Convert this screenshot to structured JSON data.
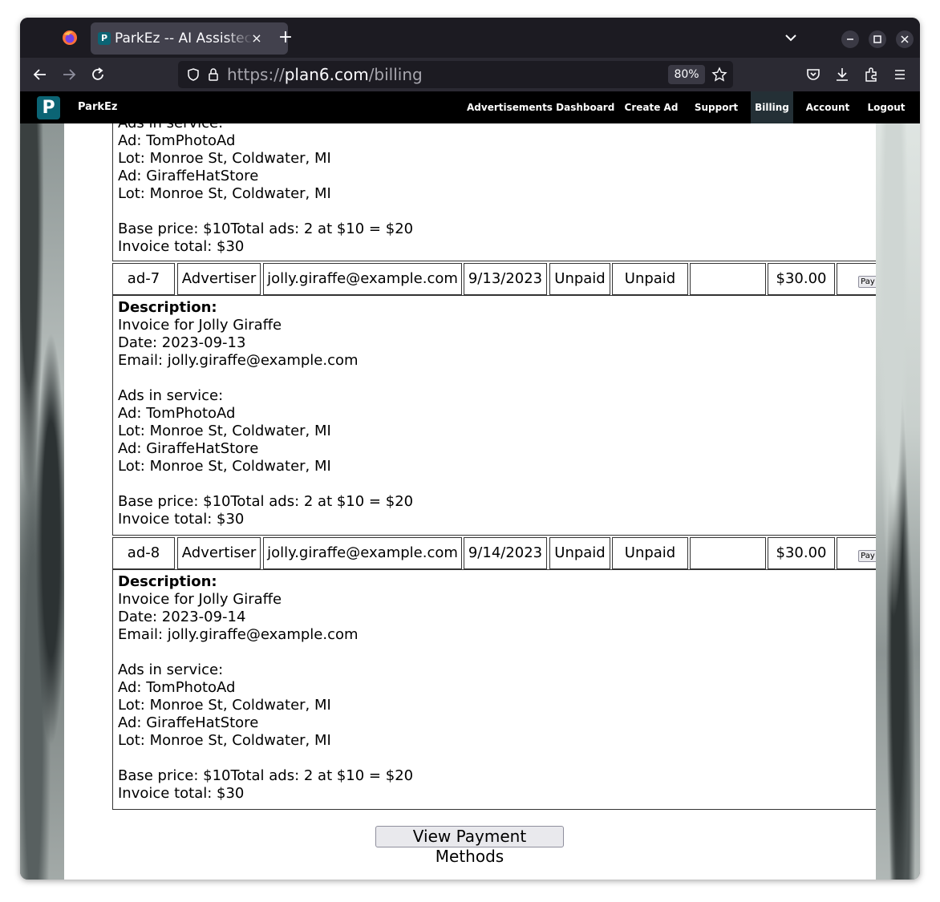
{
  "browser": {
    "tab_title": "ParkEz -- AI Assistec",
    "tab_favicon_letter": "P",
    "close_tab_glyph": "×",
    "new_tab_glyph": "+",
    "url_scheme": "https://",
    "url_host": "plan6.com",
    "url_path": "/billing",
    "zoom_level": "80%",
    "window_controls": [
      "minimize-icon",
      "maximize-icon",
      "close-icon"
    ],
    "toolbar_icons": [
      "back-icon",
      "forward-icon",
      "reload-icon",
      "shield-icon",
      "lock-icon",
      "bookmark-star-icon",
      "pocket-icon",
      "download-icon",
      "extensions-icon",
      "menu-icon"
    ]
  },
  "appnav": {
    "logo_letter": "P",
    "brand": "ParkEz",
    "links": [
      "Advertisements Dashboard",
      "Create Ad",
      "Support",
      "Billing",
      "Account",
      "Logout"
    ],
    "active": "Billing"
  },
  "billing": {
    "first_desc_partial": {
      "lines": [
        "Ads in service:",
        "Ad: TomPhotoAd",
        "Lot: Monroe St, Coldwater, MI",
        "Ad: GiraffeHatStore",
        "Lot: Monroe St, Coldwater, MI",
        "",
        "Base price: $10Total ads: 2 at $10 = $20",
        "Invoice total: $30"
      ]
    },
    "invoices": [
      {
        "row": {
          "id": "ad-7",
          "type": "Advertiser",
          "email": "jolly.giraffe@example.com",
          "date": "9/13/2023",
          "status": "Unpaid",
          "payment_status": "Unpaid",
          "blank": "",
          "amount": "$30.00",
          "pay_label": "Pay"
        },
        "desc": {
          "heading": "Description:",
          "lines": [
            "Invoice for Jolly Giraffe",
            "Date: 2023-09-13",
            "Email: jolly.giraffe@example.com",
            "",
            "Ads in service:",
            "Ad: TomPhotoAd",
            "Lot: Monroe St, Coldwater, MI",
            "Ad: GiraffeHatStore",
            "Lot: Monroe St, Coldwater, MI",
            "",
            "Base price: $10Total ads: 2 at $10 = $20",
            "Invoice total: $30"
          ]
        }
      },
      {
        "row": {
          "id": "ad-8",
          "type": "Advertiser",
          "email": "jolly.giraffe@example.com",
          "date": "9/14/2023",
          "status": "Unpaid",
          "payment_status": "Unpaid",
          "blank": "",
          "amount": "$30.00",
          "pay_label": "Pay"
        },
        "desc": {
          "heading": "Description:",
          "lines": [
            "Invoice for Jolly Giraffe",
            "Date: 2023-09-14",
            "Email: jolly.giraffe@example.com",
            "",
            "Ads in service:",
            "Ad: TomPhotoAd",
            "Lot: Monroe St, Coldwater, MI",
            "Ad: GiraffeHatStore",
            "Lot: Monroe St, Coldwater, MI",
            "",
            "Base price: $10Total ads: 2 at $10 = $20",
            "Invoice total: $30"
          ]
        }
      }
    ],
    "view_payment_methods": "View Payment Methods"
  },
  "colors": {
    "brand_teal": "#0b6474",
    "nav_bg": "#000000",
    "nav_active_bg": "#243036",
    "browser_chrome": "#2b2a33"
  }
}
